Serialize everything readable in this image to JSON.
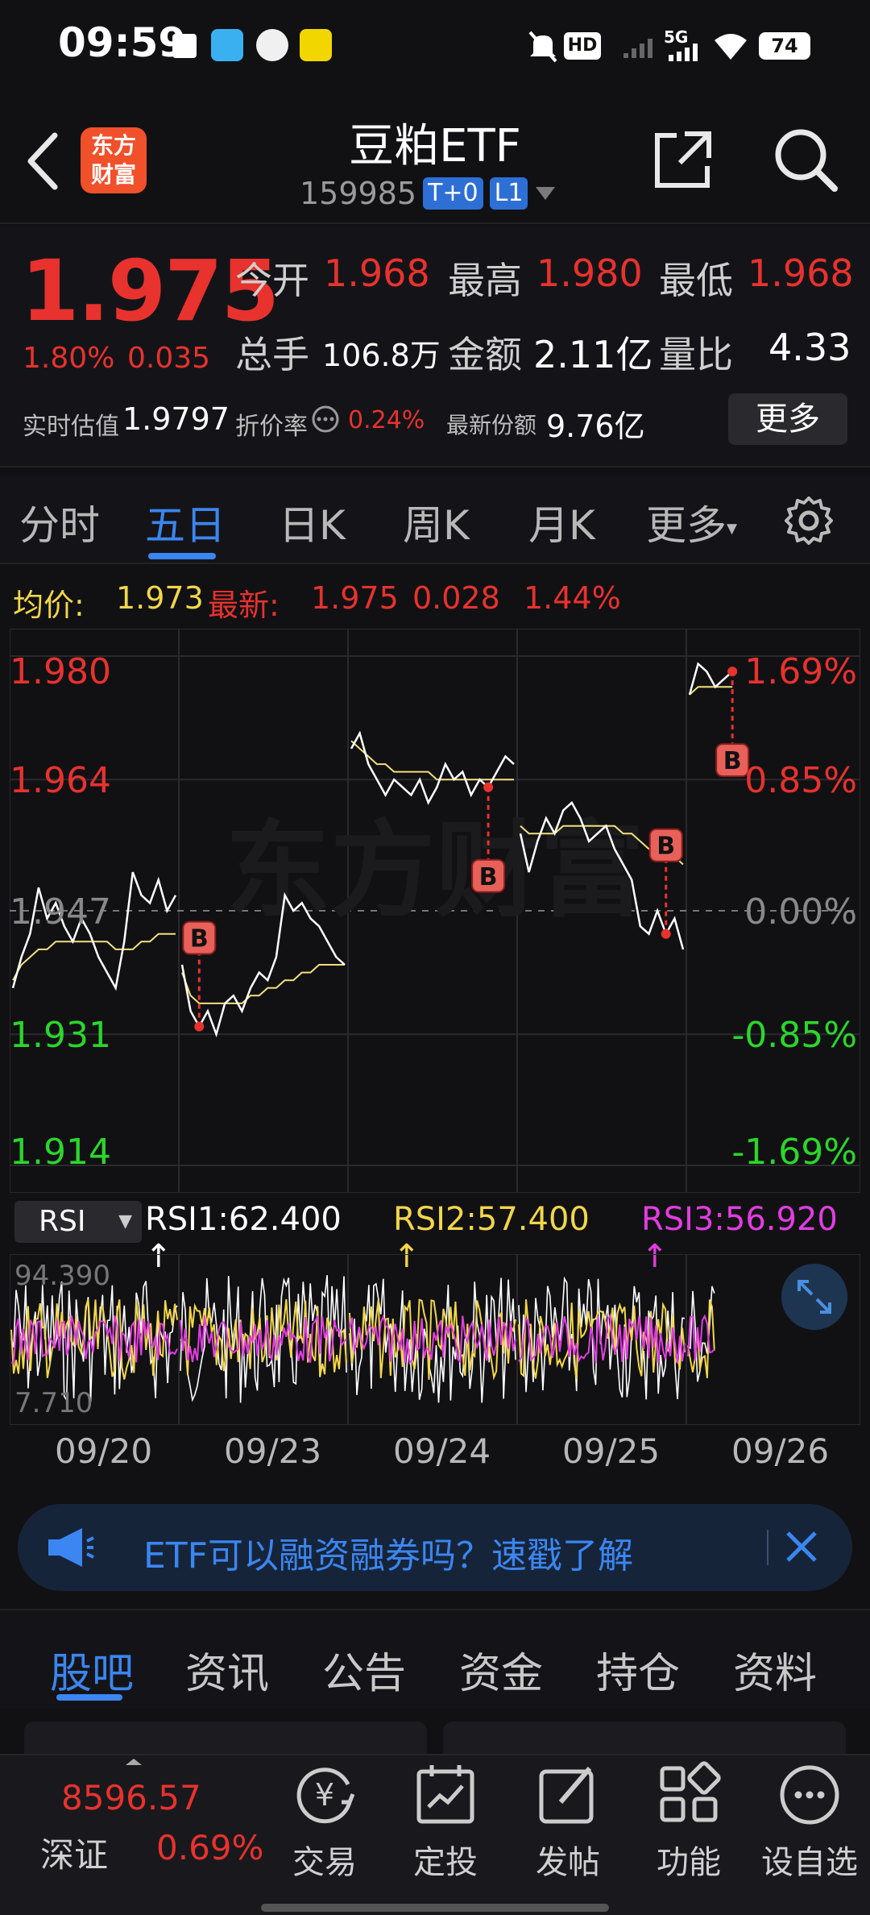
{
  "status_bar": {
    "time": "09:59",
    "network": "5G",
    "hd": "HD",
    "battery": "74"
  },
  "header": {
    "app_logo": "东方\n财富",
    "title": "豆粕ETF",
    "code": "159985",
    "tags": [
      "T+0",
      "L1"
    ]
  },
  "quote": {
    "price": "1.975",
    "change_pct": "1.80%",
    "change_abs": "0.035",
    "fields": [
      {
        "label": "今开",
        "value": "1.968",
        "color": "red"
      },
      {
        "label": "最高",
        "value": "1.980",
        "color": "red"
      },
      {
        "label": "最低",
        "value": "1.968",
        "color": "red"
      },
      {
        "label": "总手",
        "value": "106.8万",
        "color": "white"
      },
      {
        "label": "金额",
        "value": "2.11亿",
        "color": "white"
      },
      {
        "label": "量比",
        "value": "4.33",
        "color": "white"
      }
    ],
    "iopv_label": "实时估值",
    "iopv_value": "1.9797",
    "premium_label": "折价率",
    "premium_value": "0.24%",
    "shares_label": "最新份额",
    "shares_value": "9.76亿",
    "more_label": "更多"
  },
  "period_tabs": [
    "分时",
    "五日",
    "日K",
    "周K",
    "月K",
    "更多"
  ],
  "active_period": "五日",
  "chart_header": {
    "avg_label": "均价:",
    "avg_value": "1.973",
    "latest_label": "最新:",
    "latest_value": "1.975",
    "latest_change": "0.028",
    "latest_pct": "1.44%"
  },
  "chart_data": {
    "type": "line",
    "title": "",
    "y_left_ticks": [
      "1.980",
      "1.964",
      "1.947",
      "1.931",
      "1.914"
    ],
    "y_right_ticks": [
      "1.69%",
      "0.85%",
      "0.00%",
      "-0.85%",
      "-1.69%"
    ],
    "ylim": [
      1.914,
      1.98
    ],
    "prev_close": 1.947,
    "x_days": [
      "09/20",
      "09/23",
      "09/24",
      "09/25",
      "09/26"
    ],
    "watermark": "东方财富",
    "series": [
      {
        "name": "price",
        "days": [
          [
            1.937,
            1.941,
            1.944,
            1.95,
            1.946,
            1.948,
            1.945,
            1.943,
            1.946,
            1.944,
            1.941,
            1.939,
            1.937,
            1.943,
            1.952,
            1.949,
            1.948,
            1.951,
            1.947,
            1.949
          ],
          [
            1.94,
            1.934,
            1.932,
            1.934,
            1.931,
            1.935,
            1.936,
            1.934,
            1.937,
            1.939,
            1.938,
            1.941,
            1.949,
            1.947,
            1.948,
            1.946,
            1.945,
            1.943,
            1.941,
            1.94
          ],
          [
            1.968,
            1.97,
            1.966,
            1.964,
            1.962,
            1.964,
            1.963,
            1.962,
            1.964,
            1.961,
            1.963,
            1.966,
            1.964,
            1.965,
            1.962,
            1.964,
            1.963,
            1.965,
            1.967,
            1.966
          ],
          [
            1.957,
            1.952,
            1.956,
            1.959,
            1.957,
            1.96,
            1.961,
            1.959,
            1.956,
            1.957,
            1.958,
            1.955,
            1.953,
            1.951,
            1.945,
            1.944,
            1.947,
            1.944,
            1.946,
            1.942
          ],
          [
            1.975,
            1.979,
            1.978,
            1.976,
            1.977,
            1.978
          ]
        ]
      },
      {
        "name": "avg",
        "days": [
          [
            1.938,
            1.94,
            1.941,
            1.942,
            1.942,
            1.943,
            1.943,
            1.943,
            1.943,
            1.943,
            1.943,
            1.943,
            1.942,
            1.942,
            1.942,
            1.943,
            1.943,
            1.944,
            1.944,
            1.944
          ],
          [
            1.939,
            1.936,
            1.935,
            1.935,
            1.935,
            1.935,
            1.935,
            1.935,
            1.936,
            1.936,
            1.937,
            1.937,
            1.938,
            1.938,
            1.939,
            1.939,
            1.94,
            1.94,
            1.94,
            1.94
          ],
          [
            1.969,
            1.968,
            1.967,
            1.966,
            1.966,
            1.965,
            1.965,
            1.965,
            1.965,
            1.965,
            1.964,
            1.964,
            1.964,
            1.964,
            1.964,
            1.964,
            1.964,
            1.964,
            1.964,
            1.964
          ],
          [
            1.958,
            1.957,
            1.957,
            1.957,
            1.957,
            1.958,
            1.958,
            1.958,
            1.958,
            1.958,
            1.958,
            1.958,
            1.957,
            1.957,
            1.956,
            1.955,
            1.955,
            1.954,
            1.954,
            1.953
          ],
          [
            1.975,
            1.976,
            1.976,
            1.976,
            1.976,
            1.976
          ]
        ]
      }
    ],
    "buy_markers": [
      {
        "day": 1,
        "index": 2,
        "label": "B"
      },
      {
        "day": 2,
        "index": 16,
        "label": "B"
      },
      {
        "day": 3,
        "index": 17,
        "label": "B"
      },
      {
        "day": 4,
        "index": 5,
        "label": "B"
      }
    ],
    "colors": {
      "price": "#ffffff",
      "avg": "#f2e07a",
      "up": "#e8322e",
      "down": "#2bd62b",
      "marker": "#e8322e"
    }
  },
  "rsi": {
    "selector": "RSI",
    "rsi1": "RSI1:62.400 ↑",
    "rsi2": "RSI2:57.400 ↑",
    "rsi3": "RSI3:56.920 ↑",
    "top_label": "94.390",
    "bottom_label": "7.710"
  },
  "banner": {
    "text": "ETF可以融资融券吗？速戳了解"
  },
  "bottom_tabs": [
    "股吧",
    "资讯",
    "公告",
    "资金",
    "持仓",
    "资料"
  ],
  "active_bottom_tab": "股吧",
  "index_ticker": {
    "value": "8596.57",
    "name": "深证",
    "pct": "0.69%"
  },
  "bottom_nav": [
    "交易",
    "定投",
    "发帖",
    "功能",
    "设自选"
  ]
}
